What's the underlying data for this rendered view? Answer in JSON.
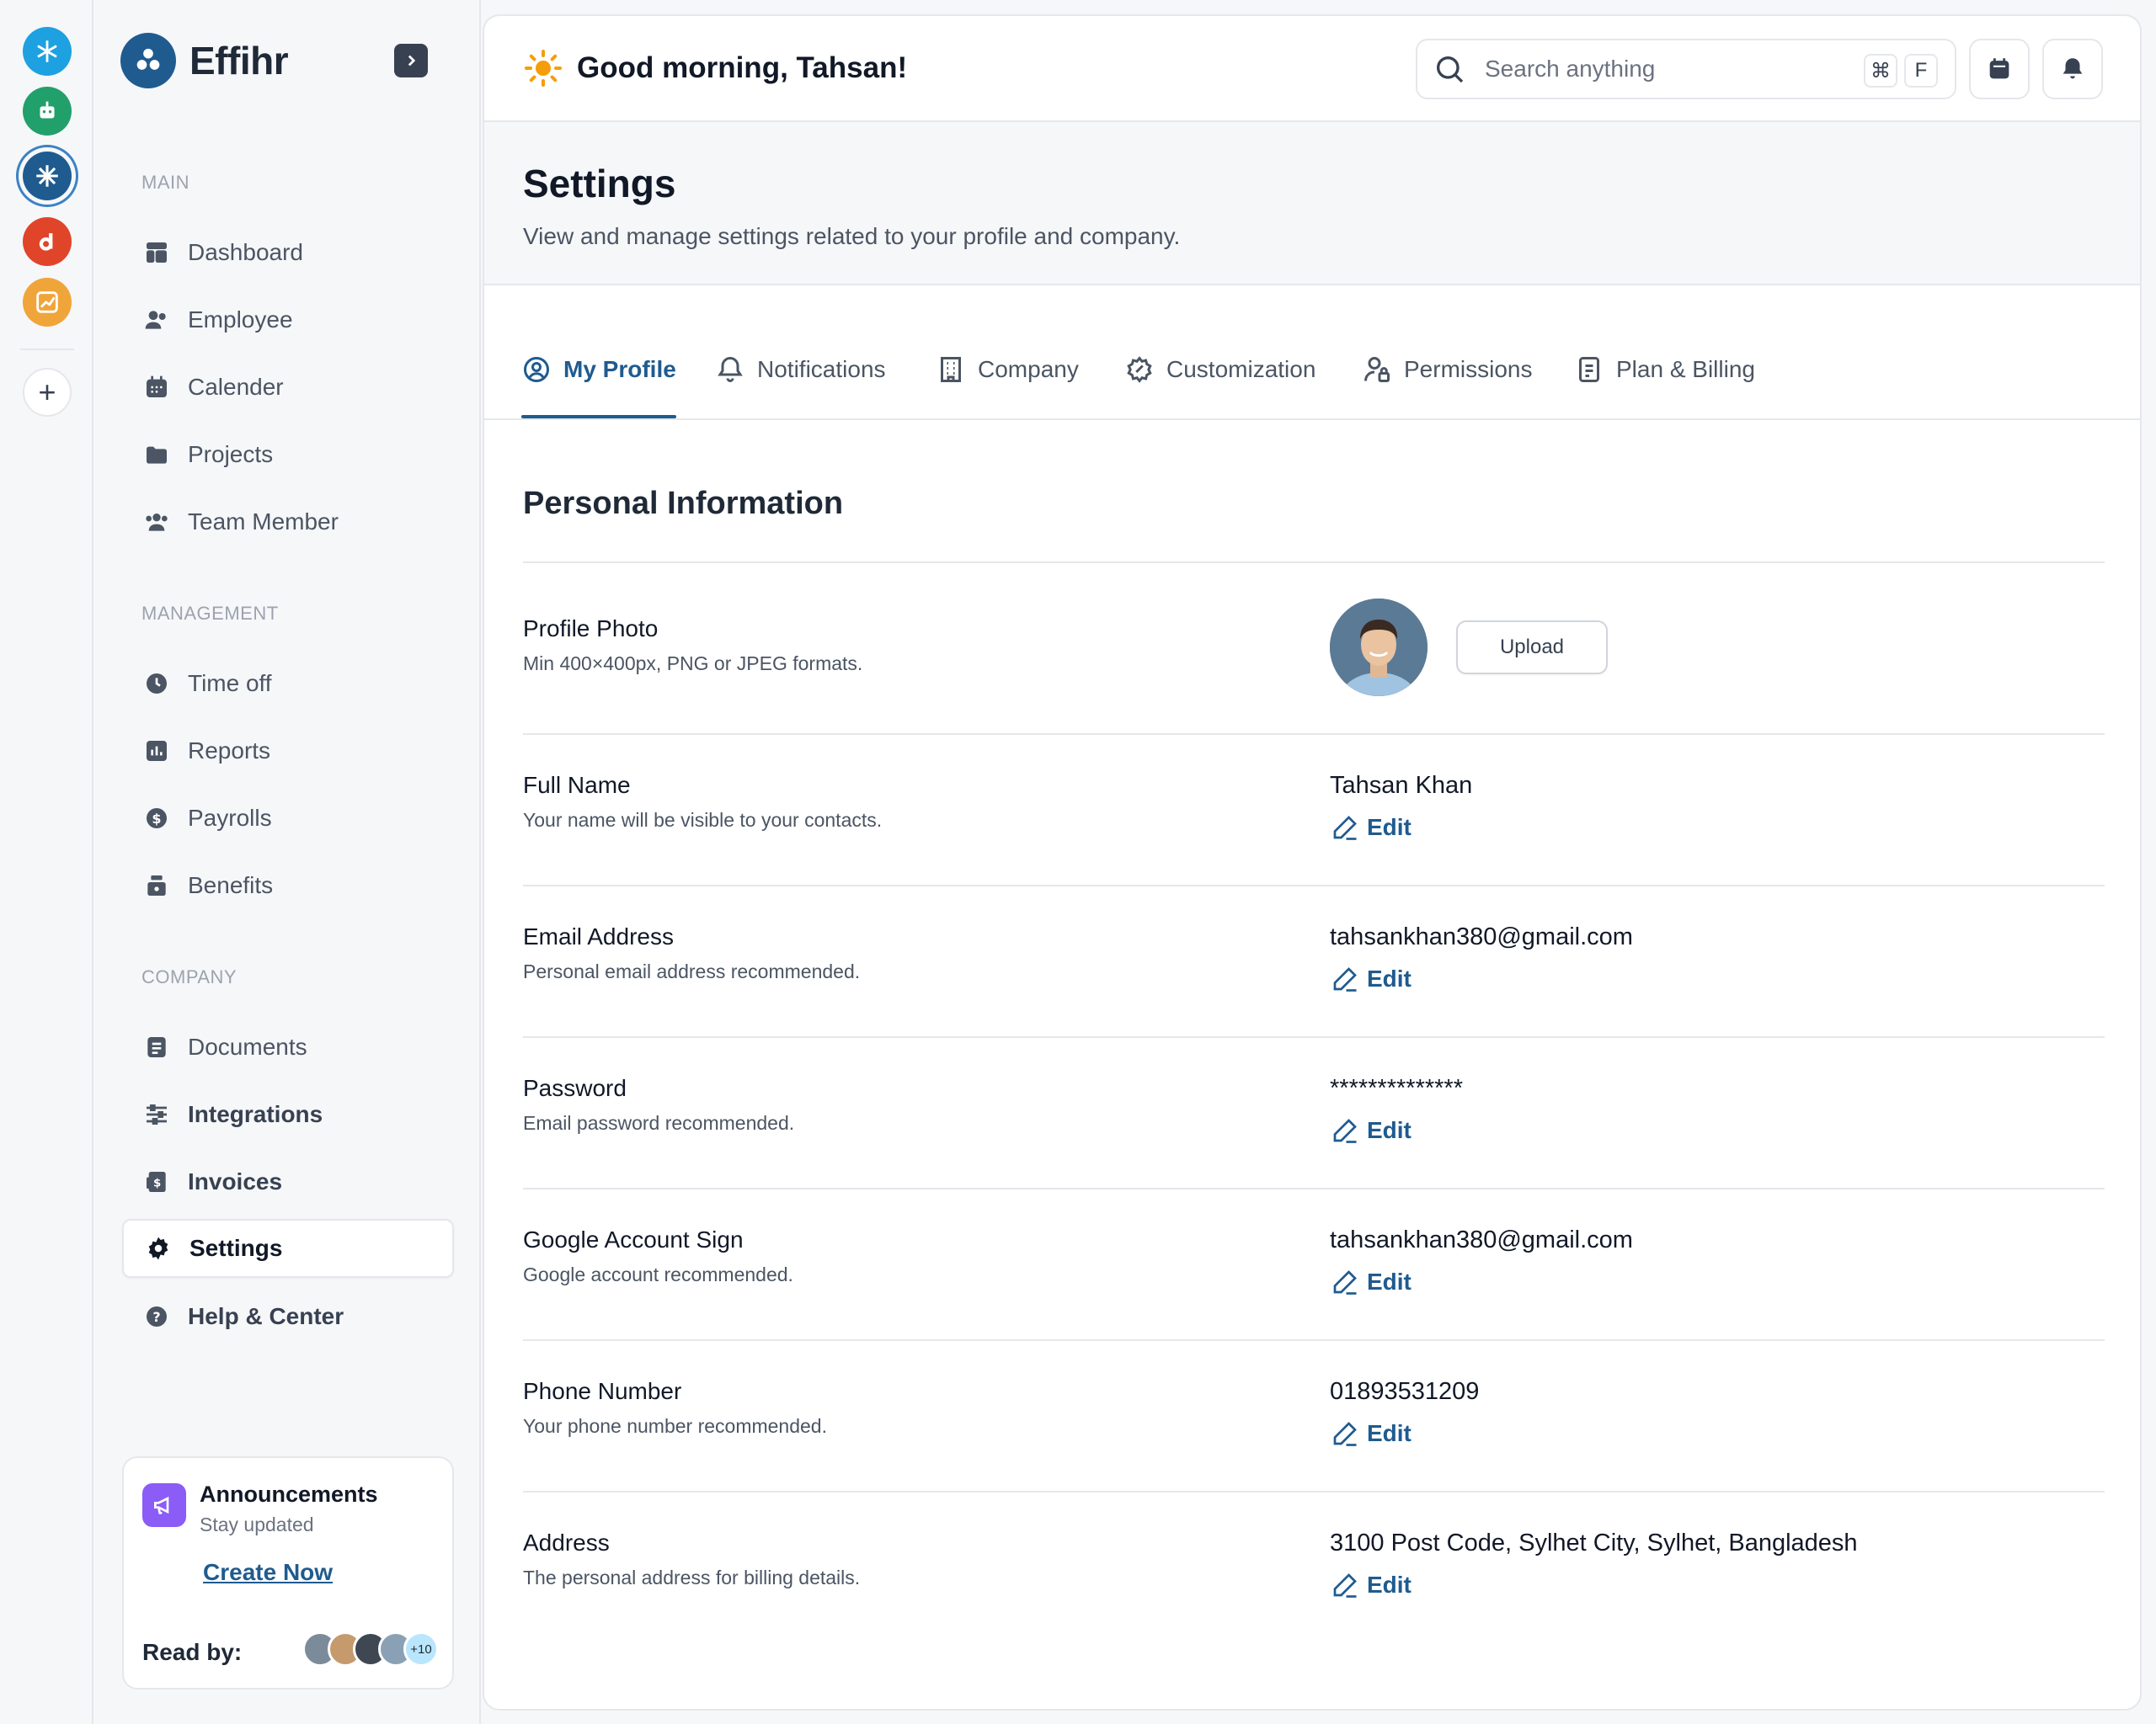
{
  "app": {
    "name": "Effihr"
  },
  "rail": {
    "add_label": "+"
  },
  "sidebar": {
    "sections": {
      "main": "MAIN",
      "management": "MANAGEMENT",
      "company": "COMPANY"
    },
    "items": [
      {
        "label": "Dashboard",
        "icon": "dashboard-icon"
      },
      {
        "label": "Employee",
        "icon": "employee-icon"
      },
      {
        "label": "Calender",
        "icon": "calendar-icon"
      },
      {
        "label": "Projects",
        "icon": "folder-icon"
      },
      {
        "label": "Team Member",
        "icon": "team-icon"
      },
      {
        "label": "Time off",
        "icon": "clock-icon"
      },
      {
        "label": "Reports",
        "icon": "reports-icon"
      },
      {
        "label": "Payrolls",
        "icon": "dollar-icon"
      },
      {
        "label": "Benefits",
        "icon": "benefits-icon"
      },
      {
        "label": "Documents",
        "icon": "document-icon"
      },
      {
        "label": "Integrations",
        "icon": "sliders-icon"
      },
      {
        "label": "Invoices",
        "icon": "invoice-icon"
      },
      {
        "label": "Settings",
        "icon": "gear-icon",
        "active": true
      },
      {
        "label": "Help & Center",
        "icon": "help-icon"
      }
    ],
    "announcement": {
      "title": "Announcements",
      "subtitle": "Stay updated",
      "link": "Create Now",
      "read_by": "Read by:",
      "more_count": "+10"
    }
  },
  "topbar": {
    "greeting": "Good morning, Tahsan!",
    "search_placeholder": "Search anything",
    "shortcut_mod": "⌘",
    "shortcut_key": "F"
  },
  "page": {
    "title": "Settings",
    "subtitle": "View and manage settings related to your profile and company."
  },
  "tabs": [
    {
      "label": "My Profile",
      "icon": "user-circle-icon",
      "active": true
    },
    {
      "label": "Notifications",
      "icon": "bell-icon"
    },
    {
      "label": "Company",
      "icon": "building-icon"
    },
    {
      "label": "Customization",
      "icon": "customize-icon"
    },
    {
      "label": "Permissions",
      "icon": "user-lock-icon"
    },
    {
      "label": "Plan & Billing",
      "icon": "receipt-icon"
    }
  ],
  "profile": {
    "section_title": "Personal Information",
    "photo": {
      "label": "Profile Photo",
      "help": "Min 400×400px, PNG or JPEG formats.",
      "button": "Upload"
    },
    "edit_label": "Edit",
    "fields": [
      {
        "label": "Full Name",
        "help": "Your name will be visible to your contacts.",
        "value": "Tahsan Khan"
      },
      {
        "label": "Email Address",
        "help": "Personal email address recommended.",
        "value": "tahsankhan380@gmail.com"
      },
      {
        "label": "Password",
        "help": "Email password recommended.",
        "value": "**************"
      },
      {
        "label": "Google Account Sign",
        "help": "Google account recommended.",
        "value": "tahsankhan380@gmail.com"
      },
      {
        "label": "Phone Number",
        "help": "Your phone number recommended.",
        "value": "01893531209"
      },
      {
        "label": "Address",
        "help": "The personal address for billing details.",
        "value": "3100 Post Code, Sylhet City, Sylhet, Bangladesh"
      }
    ]
  },
  "colors": {
    "accent": "#1f5b8f",
    "border": "#e5e7eb",
    "muted_bg": "#f6f7f9"
  }
}
